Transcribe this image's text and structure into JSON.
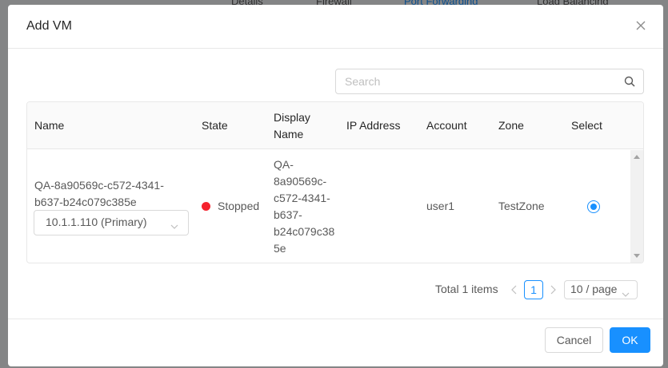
{
  "background": {
    "tabs": [
      "Details",
      "Firewall",
      "Port Forwarding",
      "Load Balancing"
    ],
    "active_tab": "Port Forwarding"
  },
  "modal": {
    "title": "Add VM"
  },
  "search": {
    "placeholder": "Search",
    "value": ""
  },
  "table": {
    "headers": {
      "name": "Name",
      "state": "State",
      "display_name": [
        "Display",
        "Name"
      ],
      "ip_address": "IP Address",
      "account": "Account",
      "zone": "Zone",
      "select": "Select"
    },
    "rows": [
      {
        "name_lines": [
          "QA-8a90569c-c572-4341-",
          "b637-b24c079c385e"
        ],
        "ip_select": "10.1.1.110 (Primary)",
        "state": "Stopped",
        "state_color": "#f5222d",
        "display_name_lines": [
          "QA-",
          "8a90569c-",
          "c572-4341-",
          "b637-",
          "b24c079c38",
          "5e"
        ],
        "ip_address": "",
        "account": "user1",
        "zone": "TestZone",
        "selected": true
      }
    ]
  },
  "pagination": {
    "total_text": "Total 1 items",
    "current_page": "1",
    "page_size": "10 / page"
  },
  "footer": {
    "cancel_label": "Cancel",
    "ok_label": "OK"
  },
  "colors": {
    "primary": "#1890ff",
    "stopped": "#f5222d"
  }
}
